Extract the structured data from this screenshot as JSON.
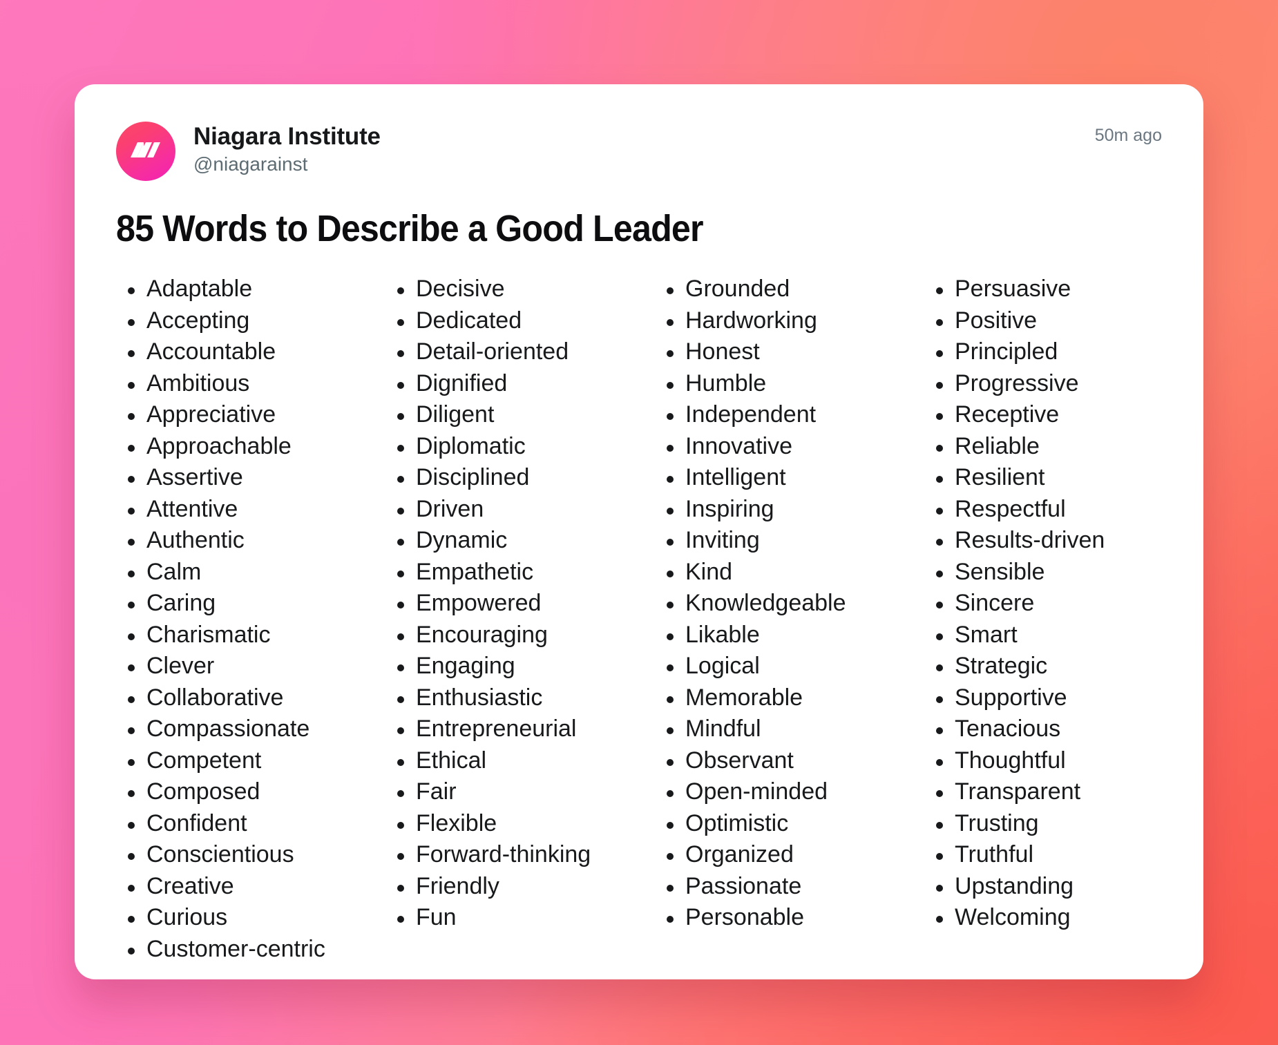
{
  "background": {
    "gradient_from": "#ff79bd",
    "gradient_mid": "#ff80a2",
    "gradient_to": "#fb6258"
  },
  "post": {
    "account_name": "Niagara Institute",
    "account_handle": "@niagarainst",
    "timestamp": "50m ago",
    "title": "85 Words to Describe a Good Leader",
    "avatar_gradient_from": "#fb4a66",
    "avatar_gradient_to": "#f221b4",
    "columns": [
      {
        "words": [
          "Adaptable",
          "Accepting",
          "Accountable",
          "Ambitious",
          "Appreciative",
          "Approachable",
          "Assertive",
          "Attentive",
          "Authentic",
          "Calm",
          "Caring",
          "Charismatic",
          "Clever",
          "Collaborative",
          "Compassionate",
          "Competent",
          "Composed",
          "Confident",
          "Conscientious",
          "Creative",
          "Curious",
          "Customer-centric"
        ]
      },
      {
        "words": [
          "Decisive",
          "Dedicated",
          "Detail-oriented",
          "Dignified",
          "Diligent",
          "Diplomatic",
          "Disciplined",
          "Driven",
          "Dynamic",
          "Empathetic",
          "Empowered",
          "Encouraging",
          "Engaging",
          "Enthusiastic",
          "Entrepreneurial",
          "Ethical",
          "Fair",
          "Flexible",
          "Forward-thinking",
          "Friendly",
          "Fun"
        ]
      },
      {
        "words": [
          "Grounded",
          "Hardworking",
          "Honest",
          "Humble",
          "Independent",
          "Innovative",
          "Intelligent",
          "Inspiring",
          "Inviting",
          "Kind",
          "Knowledgeable",
          "Likable",
          "Logical",
          "Memorable",
          "Mindful",
          "Observant",
          "Open-minded",
          "Optimistic",
          "Organized",
          "Passionate",
          "Personable"
        ]
      },
      {
        "words": [
          "Persuasive",
          "Positive",
          "Principled",
          "Progressive",
          "Receptive",
          "Reliable",
          "Resilient",
          "Respectful",
          "Results-driven",
          "Sensible",
          "Sincere",
          "Smart",
          "Strategic",
          "Supportive",
          "Tenacious",
          "Thoughtful",
          "Transparent",
          "Trusting",
          "Truthful",
          "Upstanding",
          "Welcoming"
        ]
      }
    ]
  }
}
